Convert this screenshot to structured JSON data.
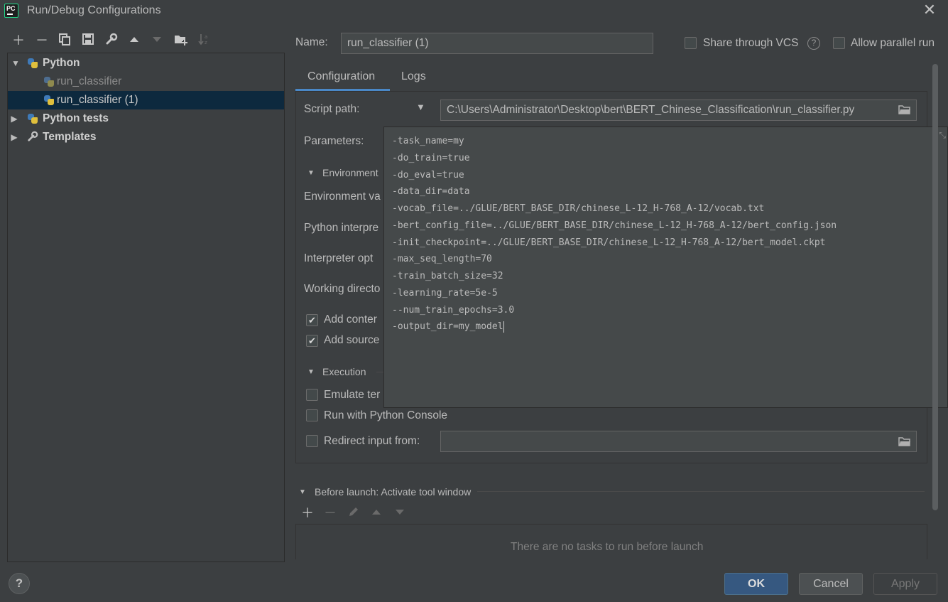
{
  "window": {
    "title": "Run/Debug Configurations",
    "app_icon": "PC"
  },
  "toolbar": {
    "icons": [
      "add-icon",
      "remove-icon",
      "copy-icon",
      "save-icon",
      "wrench-icon",
      "move-up-icon",
      "move-down-icon",
      "new-folder-icon",
      "sort-icon"
    ]
  },
  "tree": {
    "python": {
      "label": "Python"
    },
    "children": [
      {
        "label": "run_classifier"
      },
      {
        "label": "run_classifier (1)"
      }
    ],
    "python_tests": {
      "label": "Python tests"
    },
    "templates": {
      "label": "Templates"
    }
  },
  "name_row": {
    "label": "Name:",
    "value": "run_classifier (1)",
    "share_vcs": "Share through VCS",
    "allow_parallel": "Allow parallel run"
  },
  "tabs": [
    {
      "label": "Configuration"
    },
    {
      "label": "Logs"
    }
  ],
  "config": {
    "script_path_label": "Script path:",
    "script_path_value": "C:\\Users\\Administrator\\Desktop\\bert\\BERT_Chinese_Classification\\run_classifier.py",
    "parameters_label": "Parameters:",
    "environment_section": "Environment",
    "env_vars_label": "Environment va",
    "python_interpreter_label": "Python interpre",
    "interpreter_options_label": "Interpreter opt",
    "working_dir_label": "Working directo",
    "add_content_label": "Add conter",
    "add_source_label": "Add source",
    "execution_section": "Execution",
    "emulate_label": "Emulate ter",
    "run_console_label": "Run with Python Console",
    "redirect_label": "Redirect input from:"
  },
  "parameters_popup": {
    "lines": [
      "-task_name=my",
      "-do_train=true",
      "-do_eval=true",
      "-data_dir=data",
      "-vocab_file=../GLUE/BERT_BASE_DIR/chinese_L-12_H-768_A-12/vocab.txt",
      "-bert_config_file=../GLUE/BERT_BASE_DIR/chinese_L-12_H-768_A-12/bert_config.json",
      "-init_checkpoint=../GLUE/BERT_BASE_DIR/chinese_L-12_H-768_A-12/bert_model.ckpt",
      "-max_seq_length=70",
      "-train_batch_size=32",
      "-learning_rate=5e-5",
      "--num_train_epochs=3.0",
      "-output_dir=my_model"
    ]
  },
  "before_launch": {
    "title": "Before launch: Activate tool window",
    "empty_text": "There are no tasks to run before launch"
  },
  "buttons": {
    "help": "?",
    "ok": "OK",
    "cancel": "Cancel",
    "apply": "Apply"
  }
}
